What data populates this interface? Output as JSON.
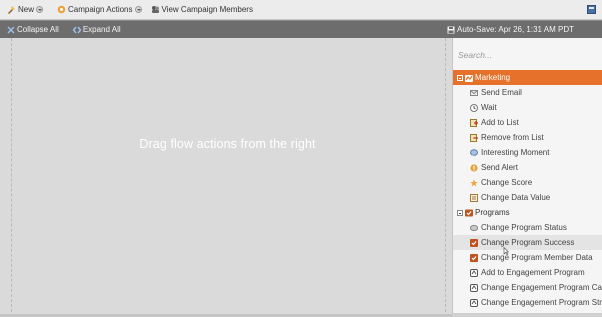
{
  "toolbar": {
    "new_label": "New",
    "campaign_actions_label": "Campaign Actions",
    "view_members_label": "View Campaign Members"
  },
  "subbar": {
    "collapse_all_label": "Collapse All",
    "expand_all_label": "Expand All",
    "autosave_text": "Auto-Save: Apr 26, 1:31 AM PDT"
  },
  "canvas": {
    "hint": "Drag flow actions from the right"
  },
  "palette": {
    "search_placeholder": "Search...",
    "marketing": {
      "label": "Marketing",
      "items": [
        {
          "label": "Send Email",
          "icon": "email-icon"
        },
        {
          "label": "Wait",
          "icon": "clock-icon"
        },
        {
          "label": "Add to List",
          "icon": "list-add-icon"
        },
        {
          "label": "Remove from List",
          "icon": "list-remove-icon"
        },
        {
          "label": "Interesting Moment",
          "icon": "chat-bubble-icon"
        },
        {
          "label": "Send Alert",
          "icon": "alert-icon"
        },
        {
          "label": "Change Score",
          "icon": "star-icon"
        },
        {
          "label": "Change Data Value",
          "icon": "data-value-icon"
        }
      ]
    },
    "programs": {
      "label": "Programs",
      "items": [
        {
          "label": "Change Program Status",
          "icon": "status-icon"
        },
        {
          "label": "Change Program Success",
          "icon": "program-icon"
        },
        {
          "label": "Change Program Member Data",
          "icon": "program-icon"
        },
        {
          "label": "Add to Engagement Program",
          "icon": "engagement-icon"
        },
        {
          "label": "Change Engagement Program Cadence",
          "icon": "engagement-icon"
        },
        {
          "label": "Change Engagement Program Stream",
          "icon": "engagement-icon"
        }
      ]
    }
  },
  "colors": {
    "accent": "#e5712a",
    "toolbar_bg": "#ececec",
    "subbar_bg": "#6d6d6d",
    "canvas_bg": "#dadada"
  }
}
